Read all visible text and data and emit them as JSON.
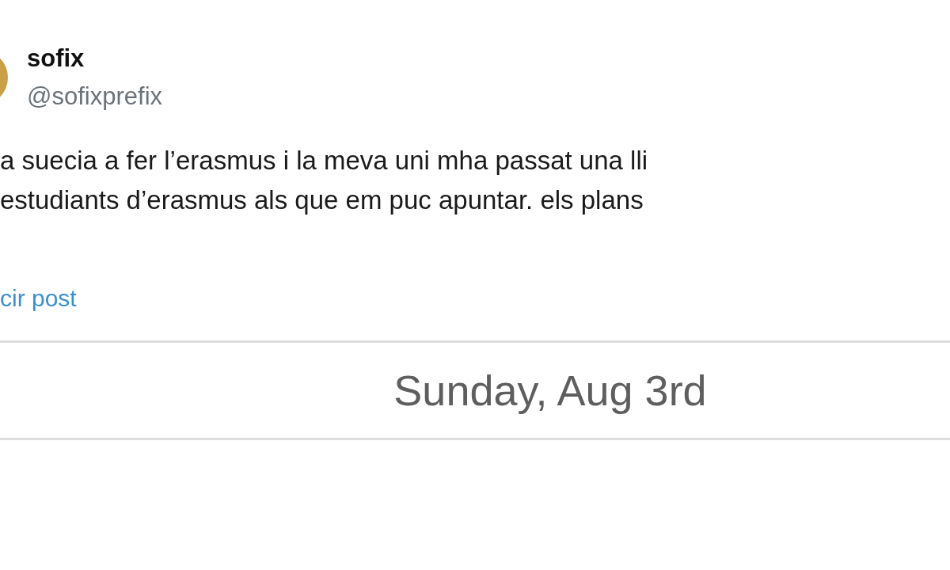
{
  "post": {
    "display_name": "sofix",
    "handle": "@sofixprefix",
    "text_lines": [
      "a suecia a fer l’erasmus i la meva uni mha passat una lli",
      "estudiants d’erasmus als que em puc apuntar. els plans"
    ],
    "link": "cir post"
  },
  "date_header": "Sunday, Aug 3rd"
}
